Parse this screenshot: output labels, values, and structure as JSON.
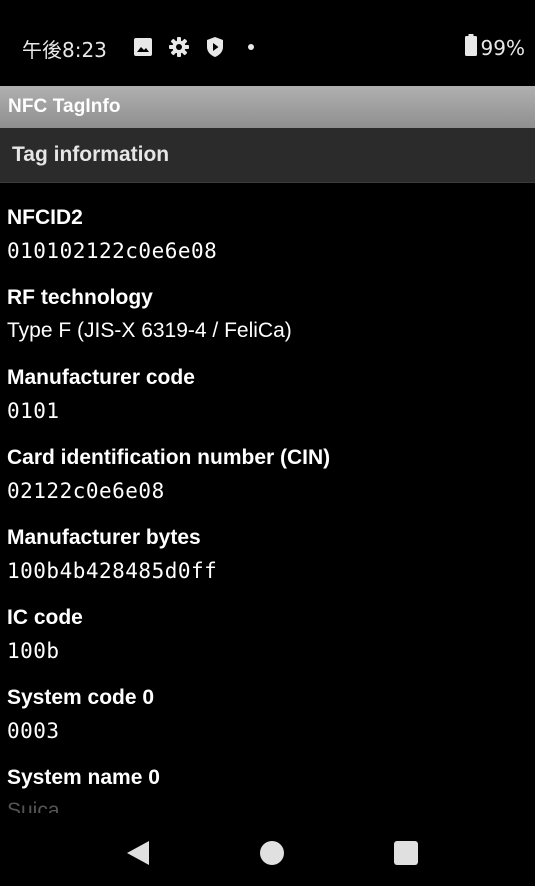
{
  "status_bar": {
    "time": "午後8:23",
    "icons": [
      "image-icon",
      "gear-icon",
      "shield-icon",
      "dot-icon"
    ],
    "battery_icon": "battery-icon",
    "battery_level": "99%"
  },
  "app_bar": {
    "title": "NFC TagInfo"
  },
  "section": {
    "title": "Tag information"
  },
  "fields": [
    {
      "label": "NFCID2",
      "value": "010102122c0e6e08"
    },
    {
      "label": "RF technology",
      "value": "Type F (JIS-X 6319-4 / FeliCa)"
    },
    {
      "label": "Manufacturer code",
      "value": "0101"
    },
    {
      "label": "Card identification number (CIN)",
      "value": "02122c0e6e08"
    },
    {
      "label": "Manufacturer bytes",
      "value": "100b4b428485d0ff"
    },
    {
      "label": "IC code",
      "value": "100b"
    },
    {
      "label": "System code 0",
      "value": "0003"
    },
    {
      "label": "System name 0",
      "value": "Suica"
    }
  ],
  "nav_bar": {
    "back": "back-icon",
    "home": "home-icon",
    "recents": "recents-icon"
  }
}
